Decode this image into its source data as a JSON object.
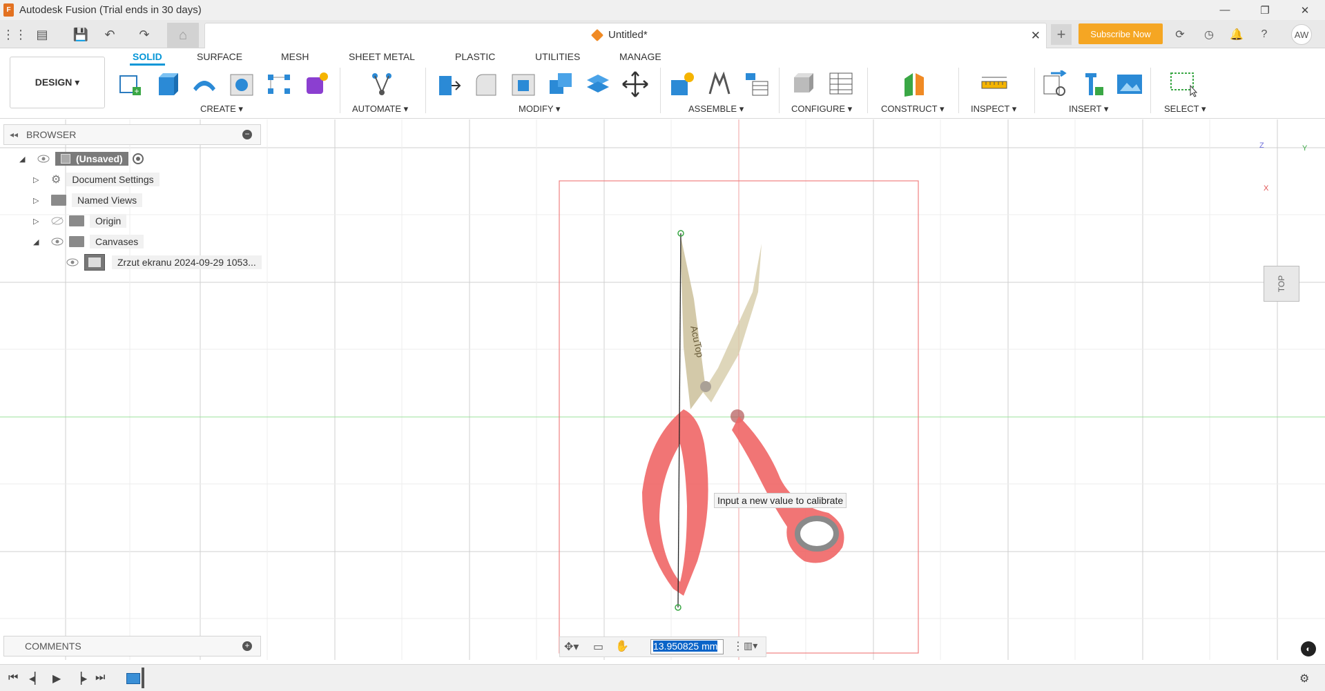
{
  "window": {
    "title": "Autodesk Fusion (Trial ends in 30 days)",
    "app_logo": "F",
    "controls": [
      "—",
      "❐",
      "✕"
    ]
  },
  "tabs": {
    "document_title": "Untitled*",
    "subscribe_label": "Subscribe Now",
    "avatar_initials": "AW"
  },
  "ribbon": {
    "workspace_label": "DESIGN ▾",
    "tabs": [
      "SOLID",
      "SURFACE",
      "MESH",
      "SHEET METAL",
      "PLASTIC",
      "UTILITIES",
      "MANAGE"
    ],
    "active_tab": "SOLID",
    "groups": [
      "CREATE ▾",
      "AUTOMATE ▾",
      "MODIFY ▾",
      "ASSEMBLE ▾",
      "CONFIGURE ▾",
      "CONSTRUCT ▾",
      "INSPECT ▾",
      "INSERT ▾",
      "SELECT ▾"
    ],
    "accent": "#0696d7"
  },
  "browser": {
    "title": "BROWSER",
    "items": [
      {
        "label": "(Unsaved)",
        "icon": "component-icon"
      },
      {
        "label": "Document Settings",
        "icon": "gear-icon"
      },
      {
        "label": "Named Views",
        "icon": "folder-icon"
      },
      {
        "label": "Origin",
        "icon": "folder-icon"
      },
      {
        "label": "Canvases",
        "icon": "folder-icon"
      },
      {
        "label": "Zrzut ekranu 2024-09-29 1053...",
        "icon": "image-icon"
      }
    ]
  },
  "comments": {
    "title": "COMMENTS"
  },
  "canvas": {
    "tooltip": "Input a new value to calibrate",
    "calibration_value": "13.950825 mm",
    "image_text": "AcuTop"
  },
  "viewcube": {
    "face": "TOP",
    "axis_z": "Z",
    "axis_y": "Y",
    "axis_x": "X"
  }
}
